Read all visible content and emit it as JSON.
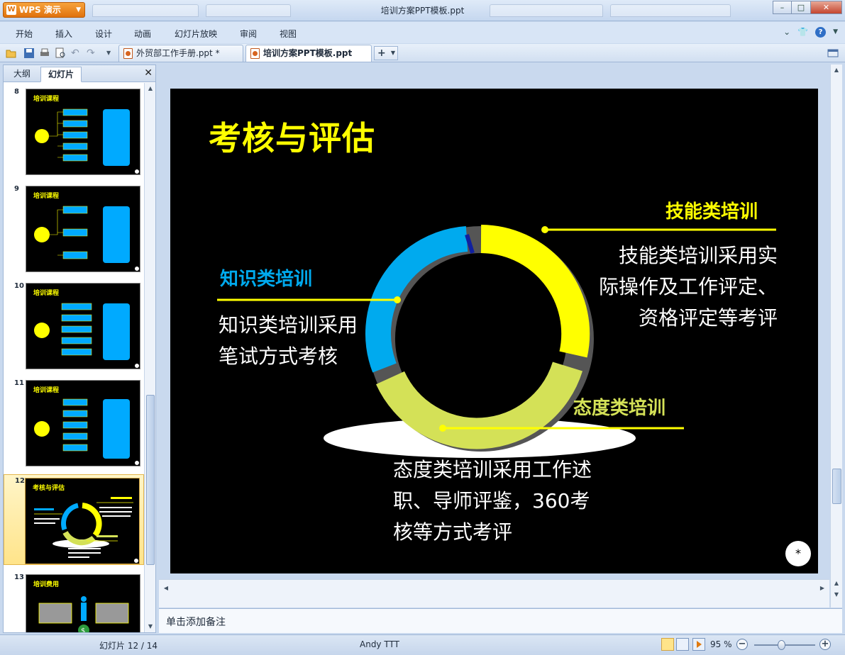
{
  "app": {
    "logo_label": "WPS 演示",
    "window_title": "培训方案PPT模板.ppt"
  },
  "menu": {
    "items": [
      "开始",
      "插入",
      "设计",
      "动画",
      "幻灯片放映",
      "审阅",
      "视图"
    ]
  },
  "tabs": [
    {
      "label": "外贸部工作手册.ppt *",
      "active": false
    },
    {
      "label": "培训方案PPT模板.ppt",
      "active": true
    }
  ],
  "left_panel": {
    "tab_outline": "大纲",
    "tab_slides": "幻灯片",
    "thumbnails": [
      {
        "number": "8",
        "title": "培训课程"
      },
      {
        "number": "9",
        "title": "培训课程"
      },
      {
        "number": "10",
        "title": "培训课程"
      },
      {
        "number": "11",
        "title": "培训课程"
      },
      {
        "number": "12",
        "title": "考核与评估",
        "selected": true
      },
      {
        "number": "13",
        "title": "培训费用"
      }
    ]
  },
  "slide": {
    "title": "考核与评估",
    "skill": {
      "heading": "技能类培训",
      "body": [
        "技能类培训采用实",
        "际操作及工作评定、",
        "资格评定等考评"
      ]
    },
    "knowledge": {
      "heading": "知识类培训",
      "body": [
        "知识类培训采用",
        "笔试方式考核"
      ]
    },
    "attitude": {
      "heading": "态度类培训",
      "body": [
        "态度类培训采用工作述",
        "职、导师评鉴，360考",
        "核等方式考评"
      ]
    },
    "page_mark": "*",
    "colors": {
      "title": "#ffff00",
      "skill": "#ffff00",
      "knowledge": "#00aaee",
      "attitude": "#d4e157"
    }
  },
  "notes": {
    "placeholder": "单击添加备注"
  },
  "status": {
    "slide_indicator": "幻灯片 12 / 14",
    "author": "Andy TTT",
    "zoom": "95 %"
  }
}
